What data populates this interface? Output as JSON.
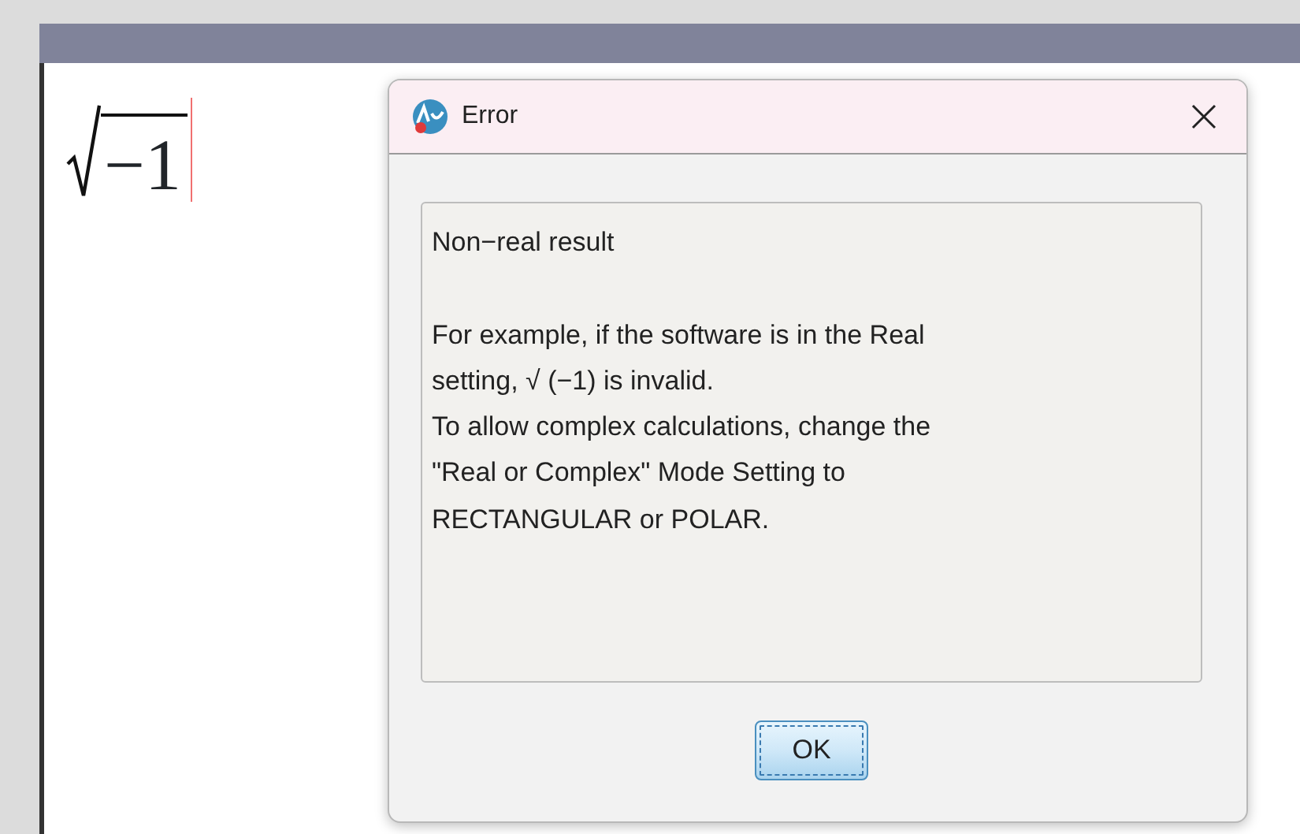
{
  "document": {
    "expression": {
      "kind": "sqrt",
      "radicand": "−1"
    },
    "cursor": true
  },
  "dialog": {
    "title": "Error",
    "message_paragraphs": [
      [
        "Non−real result"
      ],
      [
        "For example, if the software is in the Real",
        "setting,  √ (−1) is invalid.",
        "To allow complex calculations, change the",
        "\"Real or Complex\" Mode Setting to",
        "RECTANGULAR or POLAR."
      ]
    ],
    "buttons": [
      {
        "label": "OK",
        "focused": true
      }
    ]
  }
}
